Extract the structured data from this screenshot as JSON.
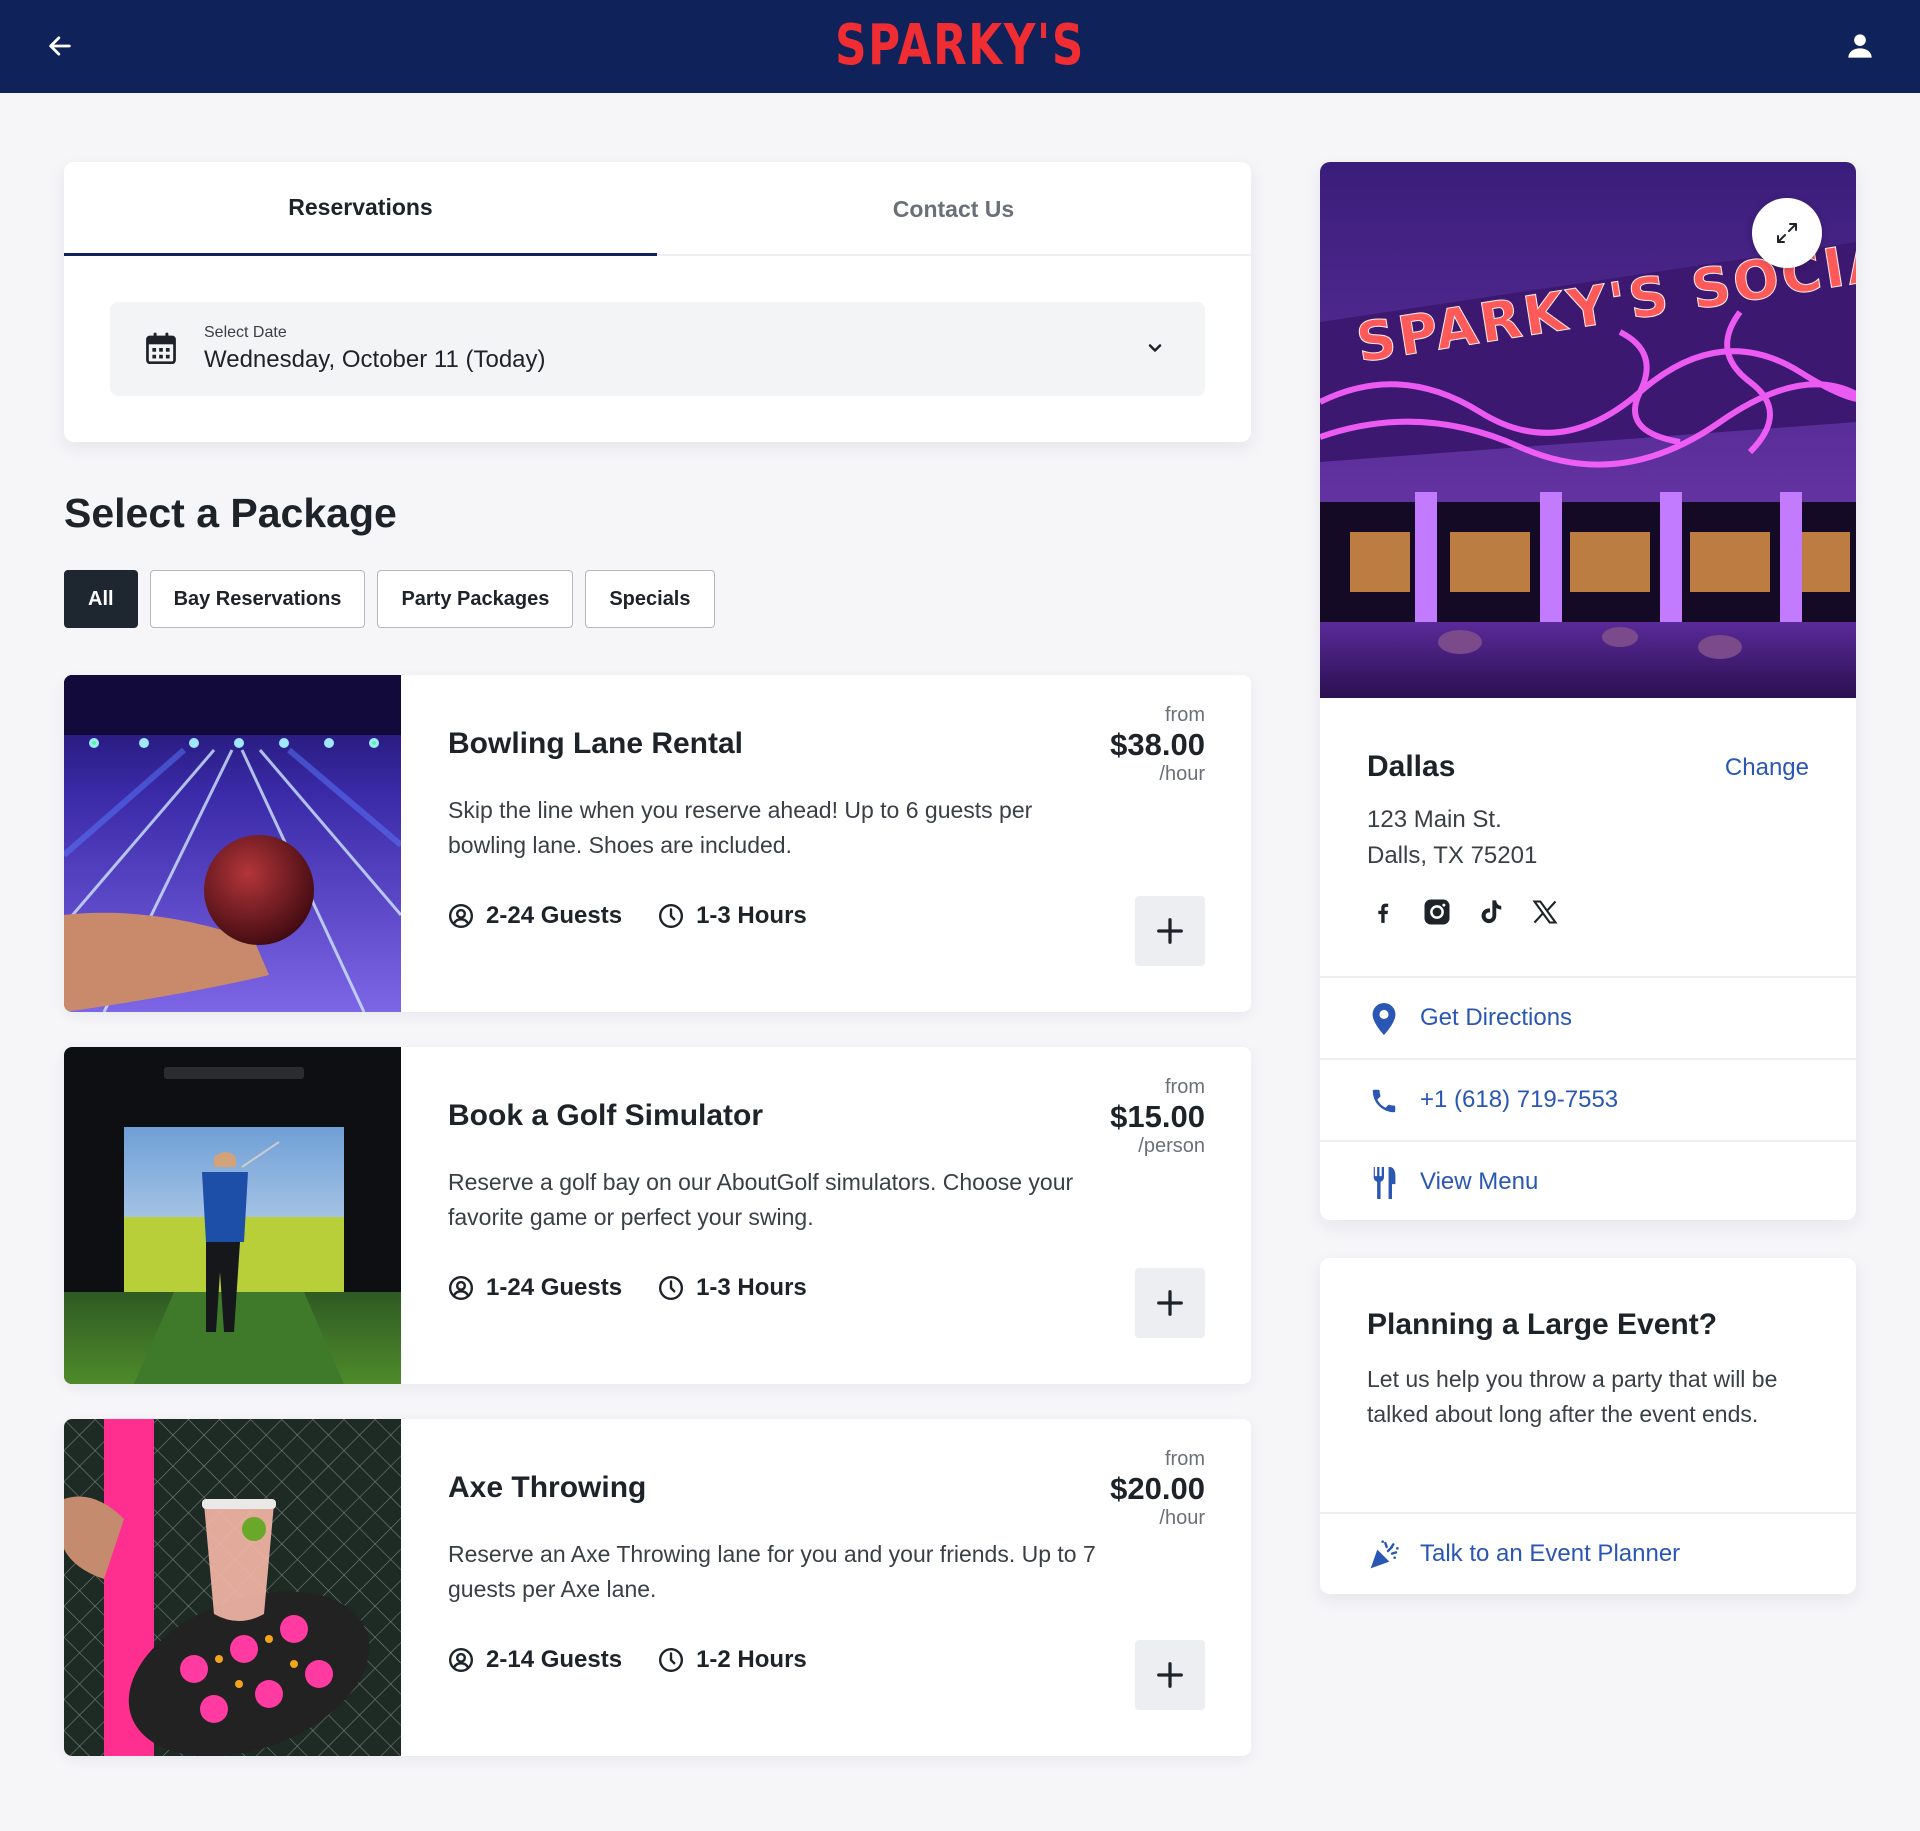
{
  "header": {
    "logo_text": "SPARKY'S",
    "back_icon": "arrow-left-icon",
    "user_icon": "user-icon"
  },
  "reservation": {
    "tabs": [
      {
        "label": "Reservations",
        "active": true
      },
      {
        "label": "Contact Us",
        "active": false
      }
    ],
    "date_select": {
      "label": "Select Date",
      "value": "Wednesday, October 11 (Today)"
    }
  },
  "packages": {
    "title": "Select a Package",
    "filters": [
      {
        "label": "All",
        "active": true
      },
      {
        "label": "Bay Reservations",
        "active": false
      },
      {
        "label": "Party Packages",
        "active": false
      },
      {
        "label": "Specials",
        "active": false
      }
    ],
    "items": [
      {
        "title": "Bowling Lane Rental",
        "description": "Skip the line when you reserve ahead! Up to 6 guests per bowling lane. Shoes are included.",
        "price_prefix": "from",
        "price": "$38.00",
        "price_unit": "/hour",
        "guests": "2-24 Guests",
        "hours": "1-3 Hours"
      },
      {
        "title": "Book a Golf Simulator",
        "description": "Reserve a golf bay on our AboutGolf simulators. Choose your favorite game or perfect your swing.",
        "price_prefix": "from",
        "price": "$15.00",
        "price_unit": "/person",
        "guests": "1-24 Guests",
        "hours": "1-3 Hours"
      },
      {
        "title": "Axe Throwing",
        "description": "Reserve an Axe Throwing lane for you and your friends. Up to 7 guests per Axe lane.",
        "price_prefix": "from",
        "price": "$20.00",
        "price_unit": "/hour",
        "guests": "2-14 Guests",
        "hours": "1-2 Hours"
      }
    ]
  },
  "location": {
    "image_sign_text": "SPARKY'S SOCIA",
    "name": "Dallas",
    "change_label": "Change",
    "address_line1": "123 Main St.",
    "address_line2": "Dalls, TX 75201",
    "socials": [
      "facebook-icon",
      "instagram-icon",
      "tiktok-icon",
      "x-icon"
    ],
    "links": [
      {
        "icon": "map-pin-icon",
        "label": "Get Directions"
      },
      {
        "icon": "phone-icon",
        "label": "+1 (618) 719-7553"
      },
      {
        "icon": "utensils-icon",
        "label": "View Menu"
      }
    ]
  },
  "event": {
    "title": "Planning a Large Event?",
    "description": "Let us help you throw a party that will be talked about long after the event ends.",
    "link_label": "Talk to an Event Planner",
    "link_icon": "party-popper-icon"
  },
  "colors": {
    "header_bg": "#10225a",
    "logo_red": "#ef2d33",
    "link_blue": "#2a57b4",
    "chip_active": "#1e2730"
  }
}
